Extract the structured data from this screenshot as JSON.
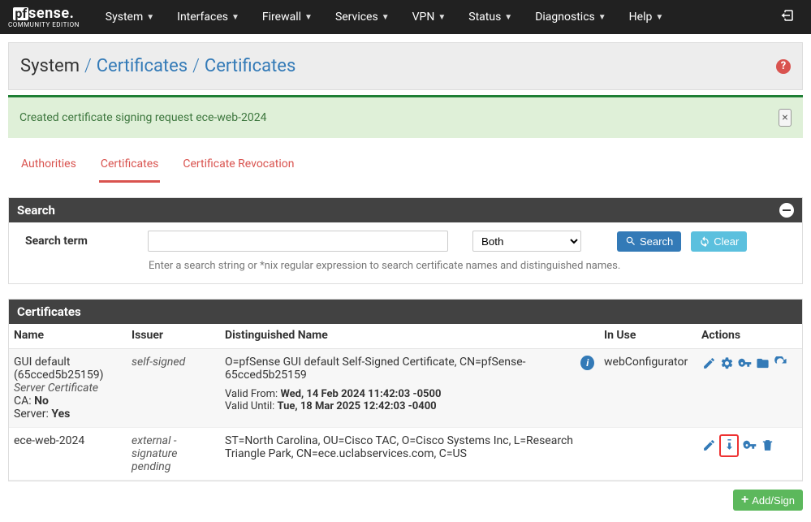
{
  "brand": {
    "pf": "pf",
    "sense": "sense",
    "sub": "COMMUNITY EDITION",
    "dot": "."
  },
  "nav": {
    "items": [
      {
        "label": "System"
      },
      {
        "label": "Interfaces"
      },
      {
        "label": "Firewall"
      },
      {
        "label": "Services"
      },
      {
        "label": "VPN"
      },
      {
        "label": "Status"
      },
      {
        "label": "Diagnostics"
      },
      {
        "label": "Help"
      }
    ]
  },
  "breadcrumb": {
    "root": "System",
    "mid": "Certificates",
    "leaf": "Certificates",
    "help": "?"
  },
  "alert": {
    "text": "Created certificate signing request ece-web-2024",
    "close": "×"
  },
  "tabs": {
    "authorities": "Authorities",
    "certificates": "Certificates",
    "revocation": "Certificate Revocation"
  },
  "search": {
    "panel_title": "Search",
    "label": "Search term",
    "placeholder": "",
    "scope": "Both",
    "btn_search": "Search",
    "btn_clear": "Clear",
    "help": "Enter a search string or *nix regular expression to search certificate names and distinguished names."
  },
  "certs": {
    "panel_title": "Certificates",
    "headers": {
      "name": "Name",
      "issuer": "Issuer",
      "dn": "Distinguished Name",
      "inuse": "In Use",
      "actions": "Actions"
    },
    "rows": [
      {
        "name": "GUI default (65cced5b25159)",
        "type": "Server Certificate",
        "ca_label": "CA:",
        "ca_value": "No",
        "server_label": "Server:",
        "server_value": "Yes",
        "issuer": "self-signed",
        "dn": "O=pfSense GUI default Self-Signed Certificate, CN=pfSense-65cced5b25159",
        "valid_from_label": "Valid From:",
        "valid_from": "Wed, 14 Feb 2024 11:42:03 -0500",
        "valid_until_label": "Valid Until:",
        "valid_until": "Tue, 18 Mar 2025 12:42:03 -0400",
        "in_use": "webConfigurator",
        "info": "i",
        "actions": "edit,gear,key,export,renew"
      },
      {
        "name": "ece-web-2024",
        "issuer": "external - signature pending",
        "dn": "ST=North Carolina, OU=Cisco TAC, O=Cisco Systems Inc, L=Research Triangle Park, CN=ece.uclabservices.com, C=US",
        "actions": "edit,import,key,trash",
        "highlight": "import"
      }
    ]
  },
  "add": {
    "label": "Add/Sign",
    "plus": "+"
  }
}
